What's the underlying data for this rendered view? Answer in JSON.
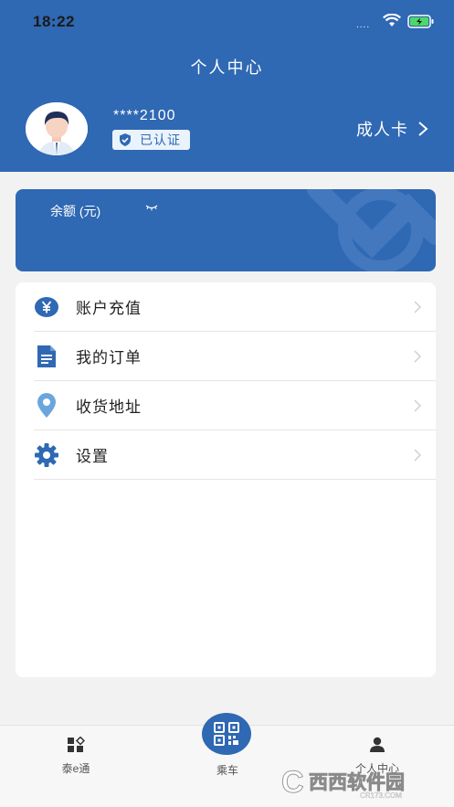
{
  "status_bar": {
    "time": "18:22",
    "signal": "...."
  },
  "header": {
    "title": "个人中心"
  },
  "profile": {
    "user_id": "****2100",
    "verified_label": "已认证",
    "card_type": "成人卡"
  },
  "balance": {
    "label": "余额 (元)"
  },
  "menu": {
    "items": [
      {
        "label": "账户充值",
        "icon": "yen-icon"
      },
      {
        "label": "我的订单",
        "icon": "document-icon"
      },
      {
        "label": "收货地址",
        "icon": "location-pin-icon"
      },
      {
        "label": "设置",
        "icon": "gear-icon"
      }
    ]
  },
  "tabbar": {
    "tabs": [
      {
        "label": "泰e通",
        "icon": "apps-icon"
      },
      {
        "label": "乘车",
        "icon": "qr-code-icon"
      },
      {
        "label": "个人中心",
        "icon": "person-icon"
      }
    ]
  },
  "watermark": {
    "text": "西西软件园",
    "url_text": "CR173.COM"
  },
  "colors": {
    "primary": "#2f68b3",
    "background": "#f2f2f2"
  }
}
